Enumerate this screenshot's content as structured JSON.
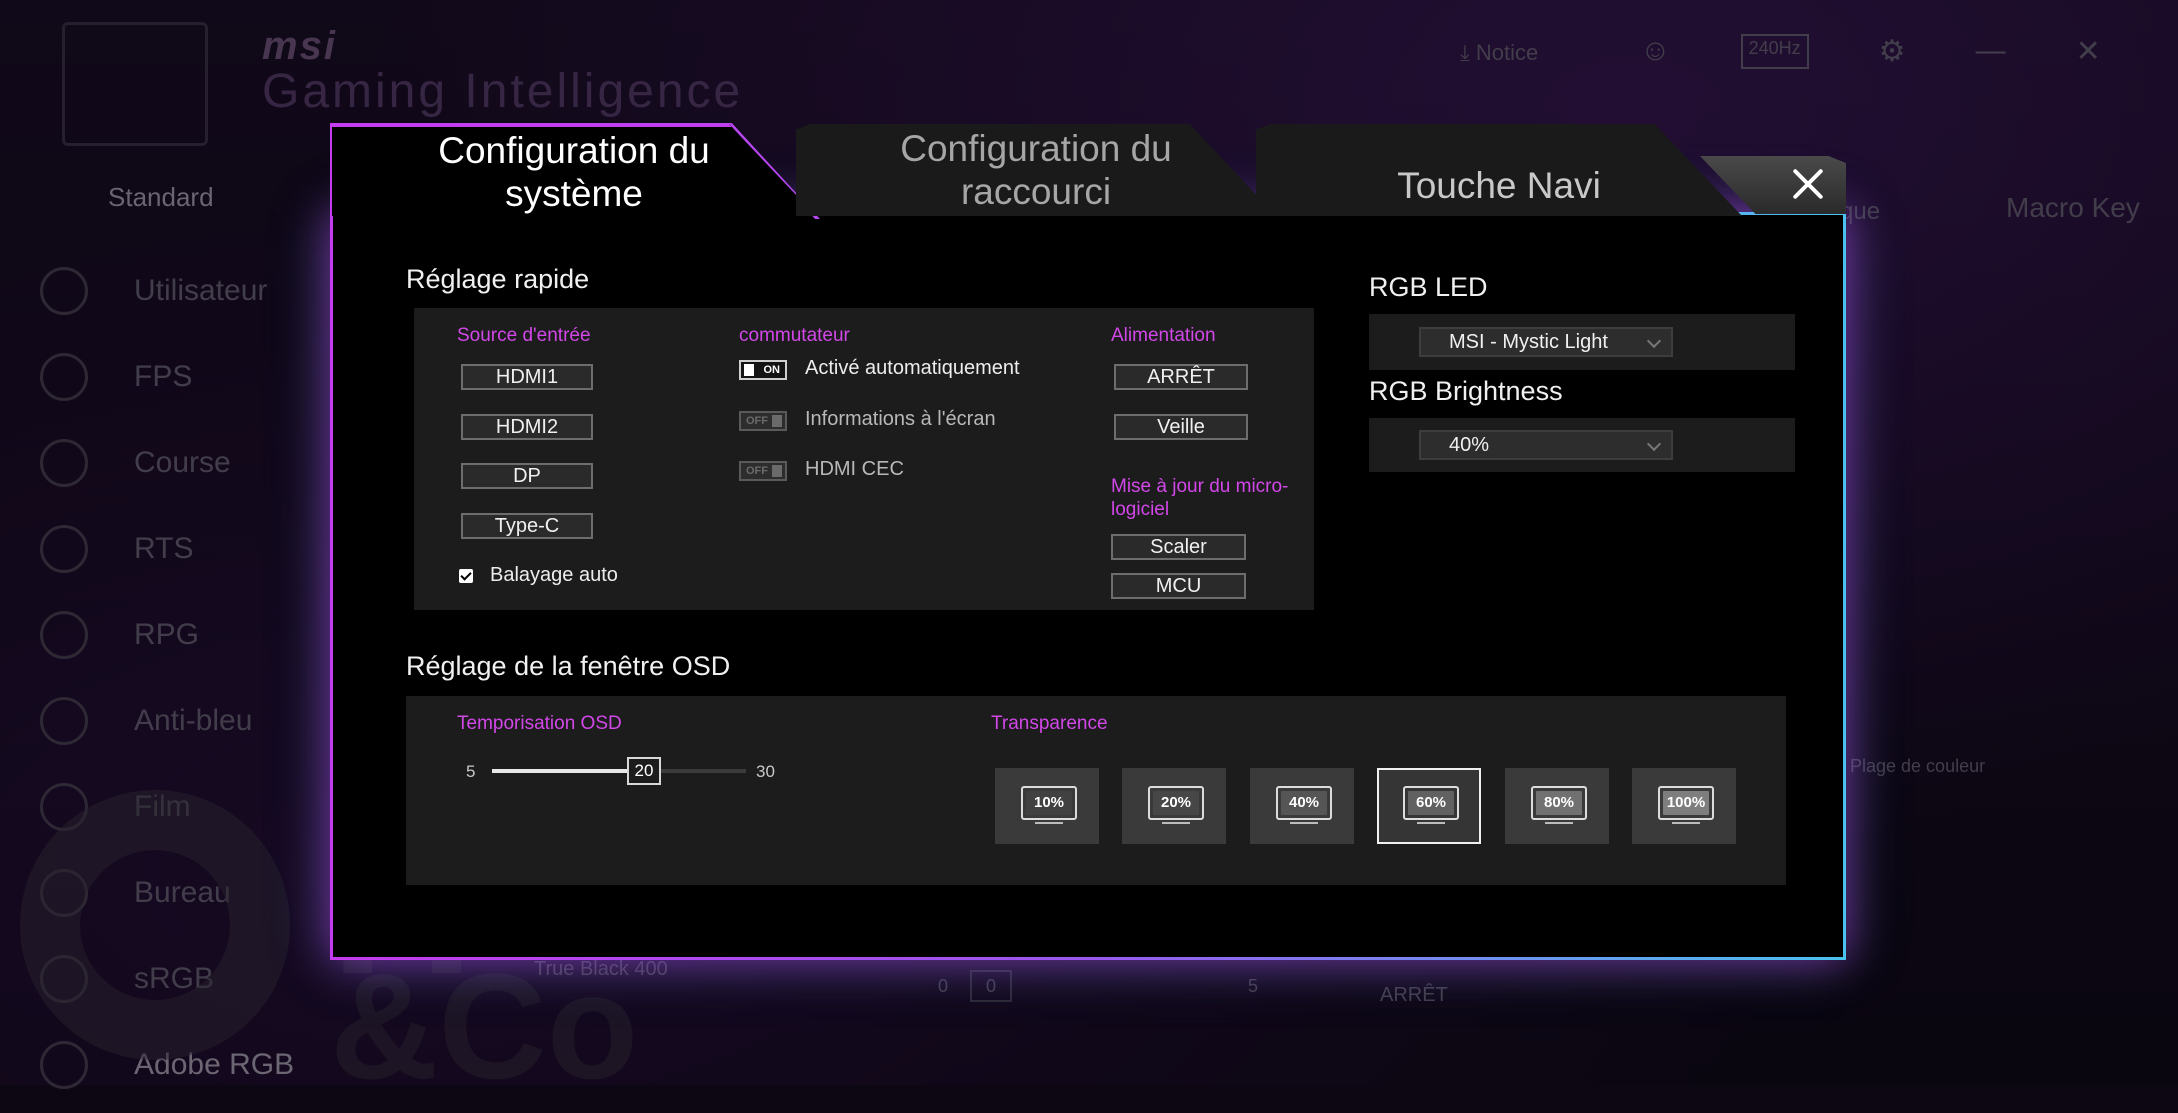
{
  "background_app": {
    "brand": "msi",
    "app_name": "Gaming Intelligence",
    "notice_label": "Notice",
    "refresh_rate_badge": "240Hz",
    "tab_standard": "Standard",
    "tab_que": "que",
    "tab_macro_key": "Macro Key",
    "sidebar_items": [
      "Utilisateur",
      "FPS",
      "Course",
      "RTS",
      "RPG",
      "Anti-bleu",
      "Film",
      "Bureau",
      "sRGB",
      "Adobe RGB"
    ],
    "true_black_label": "True Black 400",
    "slider_min": "0",
    "slider_value": "0",
    "slider_max": "5",
    "arret_label": "ARRÊT",
    "gamut_label": "Plage de couleur",
    "watermark_h": "H",
    "watermark_co": "&Co"
  },
  "dialog": {
    "tabs": {
      "system": "Configuration du système",
      "shortcut": "Configuration du raccourci",
      "navi": "Touche Navi"
    },
    "quick_settings": {
      "title": "Réglage rapide",
      "input_source": {
        "label": "Source d'entrée",
        "options": [
          "HDMI1",
          "HDMI2",
          "DP",
          "Type-C"
        ],
        "auto_scan_label": "Balayage auto",
        "auto_scan_checked": true
      },
      "switch": {
        "label": "commutateur",
        "items": [
          {
            "label": "Activé automatiquement",
            "state": "ON"
          },
          {
            "label": "Informations à l'écran",
            "state": "OFF"
          },
          {
            "label": "HDMI CEC",
            "state": "OFF"
          }
        ]
      },
      "power": {
        "label": "Alimentation",
        "options": [
          "ARRÊT",
          "Veille"
        ]
      },
      "firmware": {
        "label": "Mise à jour du micro-logiciel",
        "options": [
          "Scaler",
          "MCU"
        ]
      }
    },
    "rgb": {
      "led_title": "RGB LED",
      "led_value": "MSI - Mystic Light",
      "brightness_title": "RGB Brightness",
      "brightness_value": "40%"
    },
    "osd": {
      "title": "Réglage de la fenêtre OSD",
      "timeout_label": "Temporisation OSD",
      "timeout_min": "5",
      "timeout_max": "30",
      "timeout_value": "20",
      "transparency_label": "Transparence",
      "transparency_options": [
        "10%",
        "20%",
        "40%",
        "60%",
        "80%",
        "100%"
      ],
      "transparency_selected": "60%"
    }
  }
}
